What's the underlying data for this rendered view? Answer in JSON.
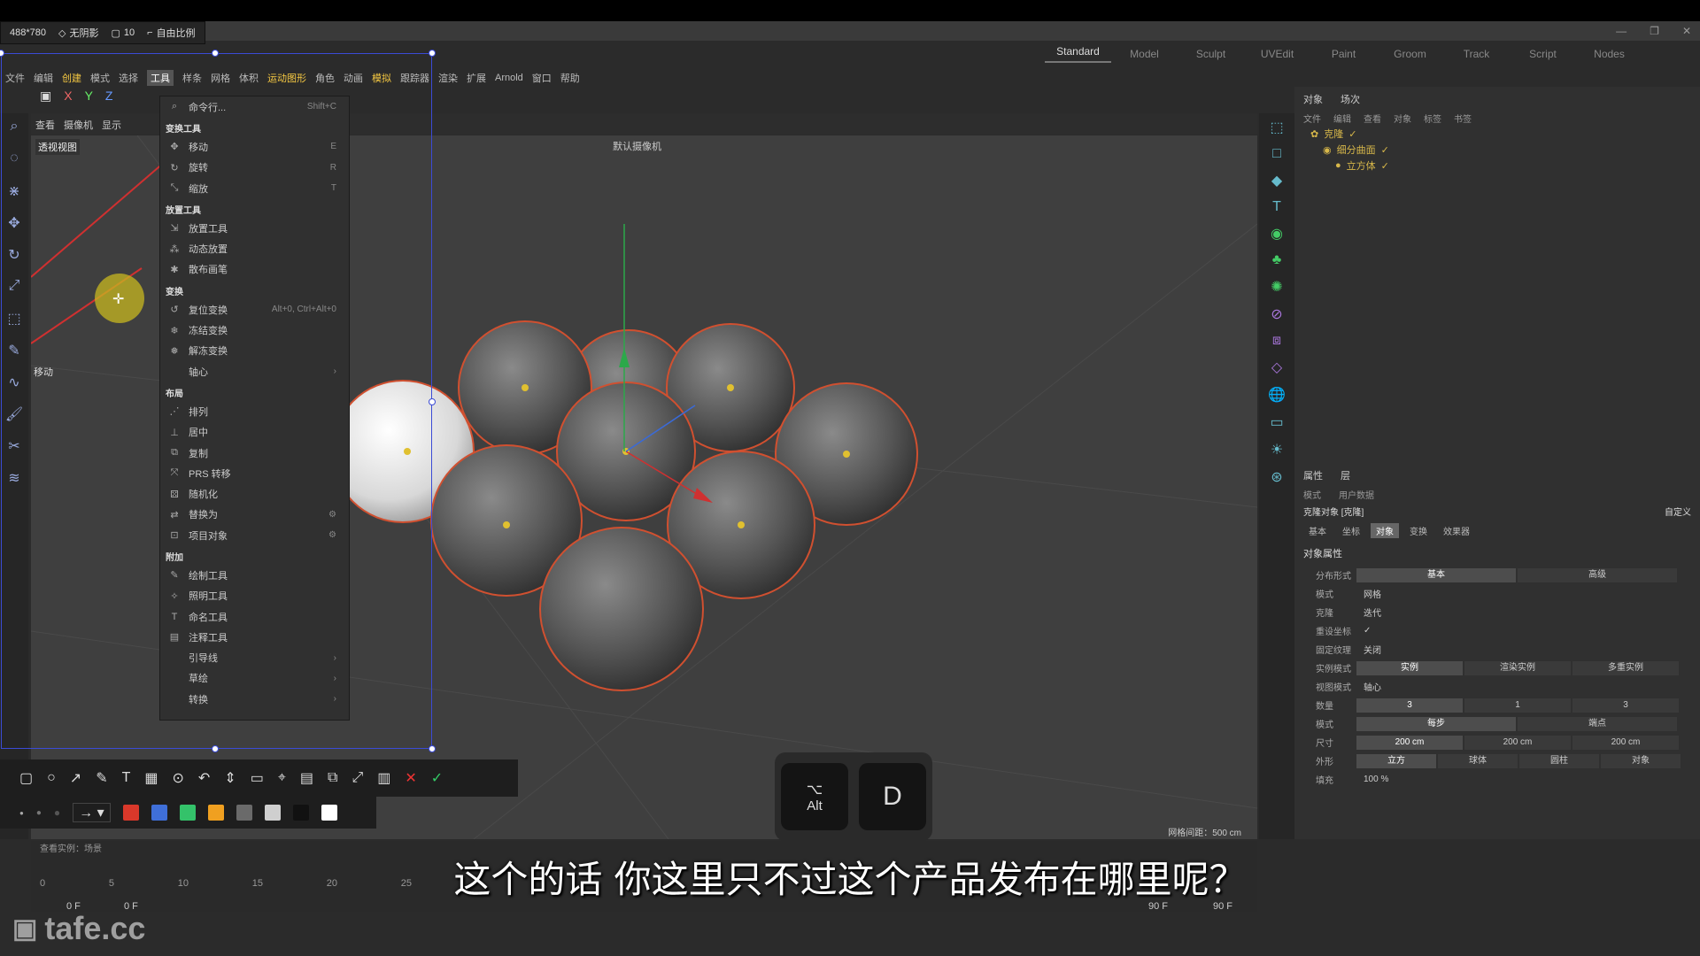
{
  "capture_bar": {
    "size": "488*780",
    "shadow": "无阴影",
    "border": "10",
    "ratio": "自由比例"
  },
  "layouts": [
    "Standard",
    "Model",
    "Sculpt",
    "UVEdit",
    "Paint",
    "Groom",
    "Track",
    "Script",
    "Nodes"
  ],
  "active_layout": "Standard",
  "menubar": [
    "文件",
    "编辑",
    "创建",
    "模式",
    "选择",
    "工具",
    "样条",
    "网格",
    "体积",
    "运动图形",
    "角色",
    "动画",
    "模拟",
    "跟踪器",
    "渲染",
    "扩展",
    "Arnold",
    "窗口",
    "帮助"
  ],
  "viewport": {
    "label": "透视视图",
    "view_menu": [
      "查看",
      "摄像机",
      "显示"
    ],
    "camera": "默认摄像机",
    "grid_info": "网格间距：500 cm",
    "move_label": "移动"
  },
  "tools_menu": {
    "search": {
      "label": "命令行...",
      "shortcut": "Shift+C"
    },
    "sections": [
      {
        "title": "变换工具",
        "items": [
          {
            "label": "移动",
            "shortcut": "E",
            "icon": "move-icon"
          },
          {
            "label": "旋转",
            "shortcut": "R",
            "icon": "rotate-icon"
          },
          {
            "label": "缩放",
            "shortcut": "T",
            "icon": "scale-icon"
          }
        ]
      },
      {
        "title": "放置工具",
        "items": [
          {
            "label": "放置工具",
            "icon": "place-icon"
          },
          {
            "label": "动态放置",
            "icon": "dynamic-place-icon"
          },
          {
            "label": "散布画笔",
            "icon": "scatter-brush-icon"
          }
        ]
      },
      {
        "title": "变换",
        "items": [
          {
            "label": "复位变换",
            "shortcut": "Alt+0, Ctrl+Alt+0",
            "icon": "reset-icon"
          },
          {
            "label": "冻结变换",
            "icon": "freeze-icon"
          },
          {
            "label": "解冻变换",
            "icon": "unfreeze-icon"
          },
          {
            "label": "轴心",
            "icon": "",
            "submenu": true
          }
        ]
      },
      {
        "title": "布局",
        "items": [
          {
            "label": "排列",
            "icon": "arrange-icon"
          },
          {
            "label": "居中",
            "icon": "center-icon"
          },
          {
            "label": "复制",
            "icon": "duplicate-icon"
          },
          {
            "label": "PRS 转移",
            "icon": "prs-transfer-icon"
          },
          {
            "label": "随机化",
            "icon": "randomize-icon"
          },
          {
            "label": "替换为",
            "icon": "replace-icon",
            "gear": true
          },
          {
            "label": "项目对象",
            "icon": "project-object-icon",
            "gear": true
          }
        ]
      },
      {
        "title": "附加",
        "items": [
          {
            "label": "绘制工具",
            "icon": "draw-tool-icon"
          },
          {
            "label": "照明工具",
            "icon": "light-tool-icon"
          },
          {
            "label": "命名工具",
            "icon": "naming-tool-icon"
          },
          {
            "label": "注释工具",
            "icon": "annotation-tool-icon"
          },
          {
            "label": "引导线",
            "icon": "",
            "submenu": true
          },
          {
            "label": "草绘",
            "icon": "",
            "submenu": true
          },
          {
            "label": "转换",
            "icon": "",
            "submenu": true
          }
        ]
      }
    ]
  },
  "keys": [
    {
      "symbol": "⌥",
      "label": "Alt"
    },
    {
      "symbol": "D",
      "label": ""
    }
  ],
  "annot_colors": [
    "#d9382a",
    "#3f6fd8",
    "#34c26a",
    "#f0a020",
    "#6a6a6a",
    "#cfcfcf",
    "#111111",
    "#ffffff"
  ],
  "objects_panel": {
    "tabs": [
      "对象",
      "场次"
    ],
    "menu": [
      "文件",
      "编辑",
      "查看",
      "对象",
      "标签",
      "书签"
    ],
    "tree": [
      "克隆",
      "细分曲面",
      "立方体"
    ]
  },
  "attributes": {
    "tabs": [
      "属性",
      "层"
    ],
    "mode_menu": [
      "模式",
      "用户数据"
    ],
    "object_title": "克隆对象 [克隆]",
    "preset": "自定义",
    "subtabs": [
      "基本",
      "坐标",
      "对象",
      "变换",
      "效果器"
    ],
    "active_subtab": "对象",
    "section": "对象属性",
    "rows": [
      {
        "label": "分布形式",
        "buttons": [
          "基本",
          "高级"
        ]
      },
      {
        "label": "模式",
        "value": "网格"
      },
      {
        "label": "克隆",
        "value": "迭代"
      },
      {
        "label": "重设坐标",
        "value": "✓"
      },
      {
        "label": "固定纹理",
        "value": "关闭"
      },
      {
        "label": "实例模式",
        "buttons": [
          "实例",
          "渲染实例",
          "多重实例"
        ]
      },
      {
        "label": "视图模式",
        "value": "轴心"
      },
      {
        "label": "数量",
        "buttons": [
          "3",
          "1",
          "3"
        ]
      },
      {
        "label": "模式",
        "buttons": [
          "每步",
          "端点"
        ]
      },
      {
        "label": "尺寸",
        "buttons": [
          "200 cm",
          "200 cm",
          "200 cm"
        ]
      },
      {
        "label": "外形",
        "buttons": [
          "立方",
          "球体",
          "圆柱",
          "对象"
        ]
      },
      {
        "label": "填充",
        "value": "100 %"
      }
    ]
  },
  "timeline": {
    "ticks": [
      "0",
      "5",
      "10",
      "15",
      "20",
      "25"
    ],
    "start": "0 F",
    "start2": "0 F",
    "end": "90 F",
    "end2": "90 F",
    "status": "查看实例：场景"
  },
  "subtitle": "这个的话 你这里只不过这个产品发布在哪里呢？",
  "watermark": "tafe.cc"
}
